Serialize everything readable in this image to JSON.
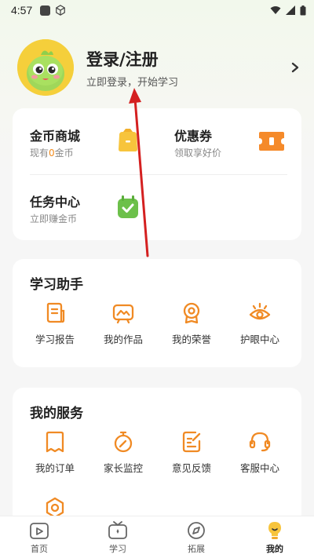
{
  "status_bar": {
    "time": "4:57"
  },
  "profile": {
    "title": "登录/注册",
    "subtitle": "立即登录，开始学习"
  },
  "assets": {
    "coins": {
      "title": "金币商城",
      "sub_prefix": "现有",
      "coin_count": "0",
      "sub_suffix": "金币"
    },
    "coupons": {
      "title": "优惠券",
      "sub": "领取享好价"
    },
    "tasks": {
      "title": "任务中心",
      "sub": "立即赚金币"
    }
  },
  "study_helper": {
    "title": "学习助手",
    "items": [
      {
        "label": "学习报告",
        "icon": "report-icon"
      },
      {
        "label": "我的作品",
        "icon": "artwork-icon"
      },
      {
        "label": "我的荣誉",
        "icon": "medal-icon"
      },
      {
        "label": "护眼中心",
        "icon": "eye-icon"
      }
    ]
  },
  "my_services": {
    "title": "我的服务",
    "items": [
      {
        "label": "我的订单",
        "icon": "order-icon"
      },
      {
        "label": "家长监控",
        "icon": "timer-icon"
      },
      {
        "label": "意见反馈",
        "icon": "feedback-icon"
      },
      {
        "label": "客服中心",
        "icon": "headset-icon"
      }
    ]
  },
  "bottom_nav": {
    "items": [
      {
        "label": "首页",
        "icon": "home-video-icon",
        "active": false
      },
      {
        "label": "学习",
        "icon": "tv-icon",
        "active": false
      },
      {
        "label": "拓展",
        "icon": "compass-icon",
        "active": false
      },
      {
        "label": "我的",
        "icon": "lightbulb-icon",
        "active": true
      }
    ]
  },
  "colors": {
    "accent": "#f28a1a",
    "icon_orange": "#f08a24",
    "coin_yellow": "#f7c43c",
    "task_green": "#6cc04a"
  }
}
